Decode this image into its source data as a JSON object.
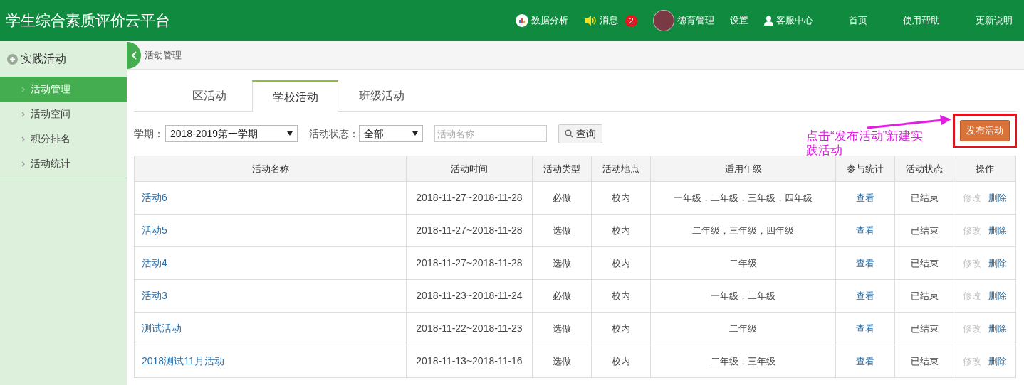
{
  "header": {
    "title": "学生综合素质评价云平台",
    "nav": [
      {
        "kind": "chart",
        "label": "数据分析"
      },
      {
        "kind": "speaker",
        "label": "消息",
        "badge": "2"
      },
      {
        "kind": "avatar",
        "label": "德育管理"
      },
      {
        "kind": "plain",
        "label": "设置"
      },
      {
        "kind": "user",
        "label": "客服中心"
      },
      {
        "kind": "plain",
        "label": "首页"
      },
      {
        "kind": "plain",
        "label": "使用帮助"
      },
      {
        "kind": "plain",
        "label": "更新说明"
      }
    ]
  },
  "sidebar": {
    "title": "实践活动",
    "items": [
      {
        "label": "活动管理",
        "selected": true
      },
      {
        "label": "活动空间",
        "selected": false
      },
      {
        "label": "积分排名",
        "selected": false
      },
      {
        "label": "活动统计",
        "selected": false
      }
    ]
  },
  "breadcrumb": "活动管理",
  "tabs": [
    {
      "label": "区活动",
      "selected": false
    },
    {
      "label": "学校活动",
      "selected": true
    },
    {
      "label": "班级活动",
      "selected": false
    }
  ],
  "filters": {
    "term_label": "学期：",
    "term_value": "2018-2019第一学期",
    "status_label": "活动状态：",
    "status_value": "全部",
    "search_placeholder": "活动名称",
    "query_button": "查询"
  },
  "annotation": "点击“发布活动”新建实践活动",
  "publish_button": "发布活动",
  "table": {
    "columns": [
      "活动名称",
      "活动时间",
      "活动类型",
      "活动地点",
      "适用年级",
      "参与统计",
      "活动状态",
      "操作"
    ],
    "rows": [
      {
        "name": "活动6",
        "time": "2018-11-27~2018-11-28",
        "type": "必做",
        "place": "校内",
        "grades": "一年级，二年级，三年级，四年级",
        "stats": "查看",
        "status": "已结束",
        "actions": [
          {
            "label": "修改",
            "disabled": true
          },
          {
            "label": "删除",
            "disabled": false
          }
        ]
      },
      {
        "name": "活动5",
        "time": "2018-11-27~2018-11-28",
        "type": "选做",
        "place": "校内",
        "grades": "二年级，三年级，四年级",
        "stats": "查看",
        "status": "已结束",
        "actions": [
          {
            "label": "修改",
            "disabled": true
          },
          {
            "label": "删除",
            "disabled": false
          }
        ]
      },
      {
        "name": "活动4",
        "time": "2018-11-27~2018-11-28",
        "type": "选做",
        "place": "校内",
        "grades": "二年级",
        "stats": "查看",
        "status": "已结束",
        "actions": [
          {
            "label": "修改",
            "disabled": true
          },
          {
            "label": "删除",
            "disabled": false
          }
        ]
      },
      {
        "name": "活动3",
        "time": "2018-11-23~2018-11-24",
        "type": "必做",
        "place": "校内",
        "grades": "一年级，二年级",
        "stats": "查看",
        "status": "已结束",
        "actions": [
          {
            "label": "修改",
            "disabled": true
          },
          {
            "label": "删除",
            "disabled": false
          }
        ]
      },
      {
        "name": "测试活动",
        "time": "2018-11-22~2018-11-23",
        "type": "选做",
        "place": "校内",
        "grades": "二年级",
        "stats": "查看",
        "status": "已结束",
        "actions": [
          {
            "label": "修改",
            "disabled": true
          },
          {
            "label": "删除",
            "disabled": false
          }
        ]
      },
      {
        "name": "2018测试11月活动",
        "time": "2018-11-13~2018-11-16",
        "type": "选做",
        "place": "校内",
        "grades": "二年级，三年级",
        "stats": "查看",
        "status": "已结束",
        "actions": [
          {
            "label": "修改",
            "disabled": true
          },
          {
            "label": "删除",
            "disabled": false
          }
        ]
      }
    ]
  }
}
